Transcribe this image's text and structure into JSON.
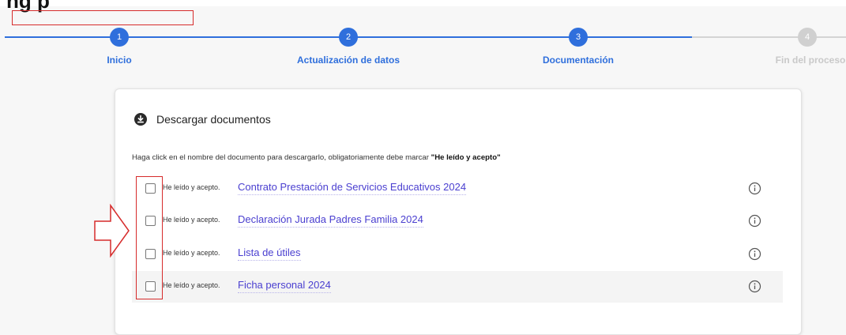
{
  "page": {
    "heading_partial": "ng p"
  },
  "stepper": {
    "steps": [
      {
        "number": "1",
        "label": "Inicio",
        "state": "active"
      },
      {
        "number": "2",
        "label": "Actualización de datos",
        "state": "active"
      },
      {
        "number": "3",
        "label": "Documentación",
        "state": "active"
      },
      {
        "number": "4",
        "label": "Fin del proceso",
        "state": "inactive"
      }
    ],
    "colors": {
      "active": "#2f6fdc",
      "inactive": "#d0d0d0"
    }
  },
  "card": {
    "title": "Descargar documentos",
    "title_icon": "download-icon",
    "instructions_prefix": "Haga click en el nombre del documento para descargarlo, obligatoriamente debe marcar ",
    "instructions_bold": "\"He leído y acepto\"",
    "documents": [
      {
        "accept_label": "He leído y acepto.",
        "name": "Contrato Prestación de Servicios Educativos 2024",
        "checked": false
      },
      {
        "accept_label": "He leído y acepto.",
        "name": "Declaración Jurada Padres Familia 2024",
        "checked": false
      },
      {
        "accept_label": "He leído y acepto.",
        "name": "Lista de útiles",
        "checked": false
      },
      {
        "accept_label": "He leído y acepto.",
        "name": "Ficha personal 2024",
        "checked": false
      }
    ]
  },
  "annotations": {
    "color": "#d62b2b"
  }
}
